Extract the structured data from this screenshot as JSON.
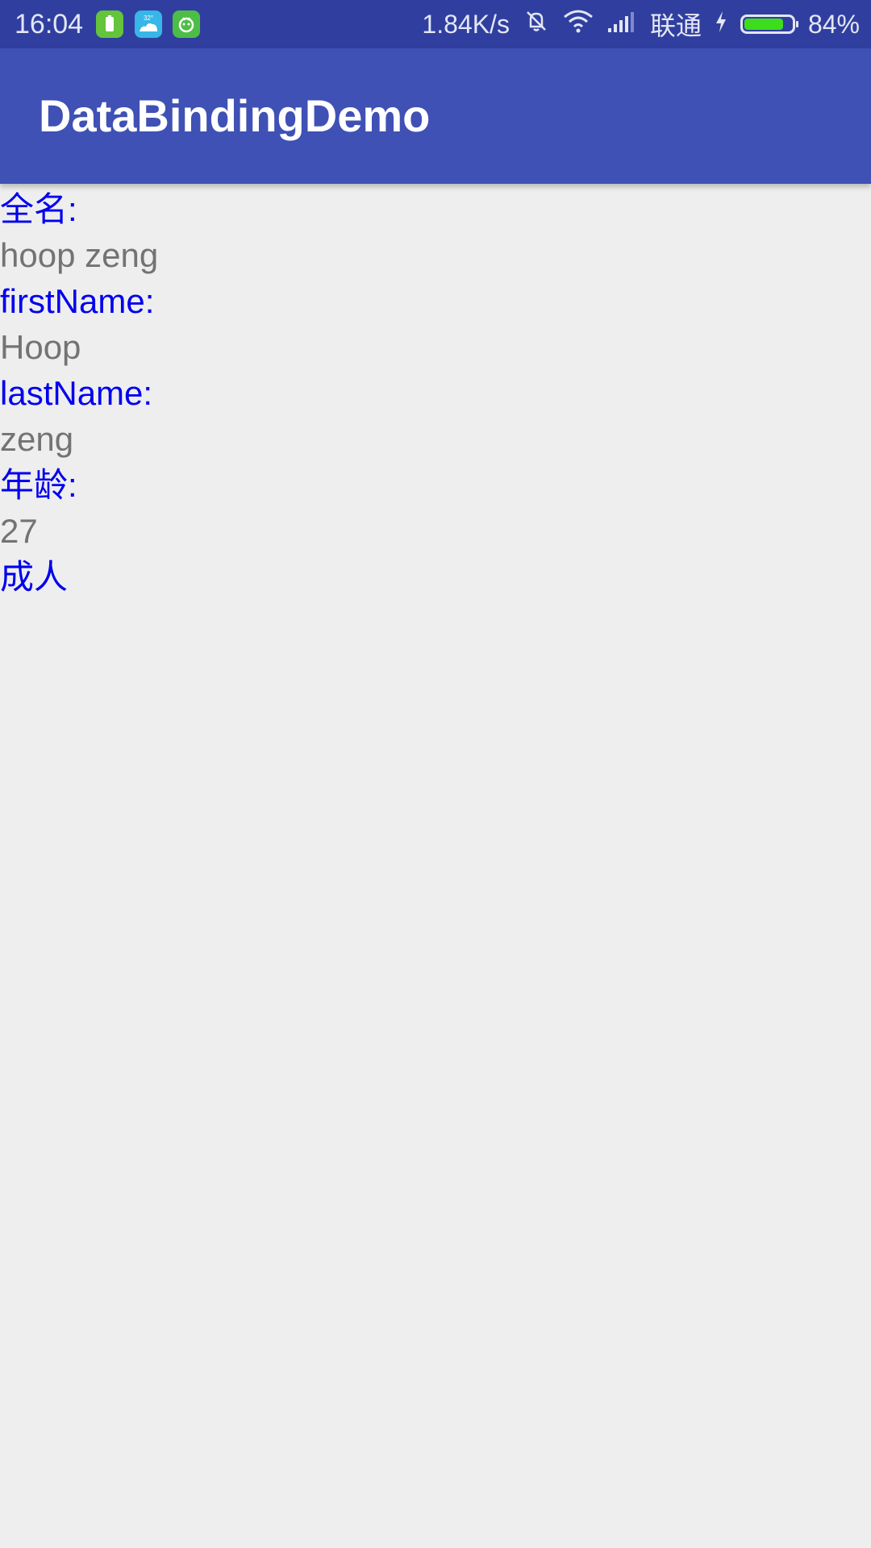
{
  "status_bar": {
    "time": "16:04",
    "network_speed": "1.84K/s",
    "carrier": "联通",
    "battery_percent": "84%",
    "battery_level": 0.84,
    "icons": [
      "battery-app-icon",
      "weather-app-icon",
      "android-app-icon",
      "silent-alarm-icon",
      "wifi-icon",
      "signal-icon",
      "charging-icon",
      "battery-icon"
    ],
    "weather_temp": "32°"
  },
  "app_bar": {
    "title": "DataBindingDemo",
    "color": "#3f51b5"
  },
  "content": {
    "full_name_label": "全名:",
    "full_name_value": "hoop zeng",
    "first_name_label": "firstName:",
    "first_name_value": "Hoop",
    "last_name_label": "lastName:",
    "last_name_value": "zeng",
    "age_label": "年龄:",
    "age_value": "27",
    "adult_status": "成人",
    "label_color": "#0000ee",
    "value_color": "#737373"
  }
}
